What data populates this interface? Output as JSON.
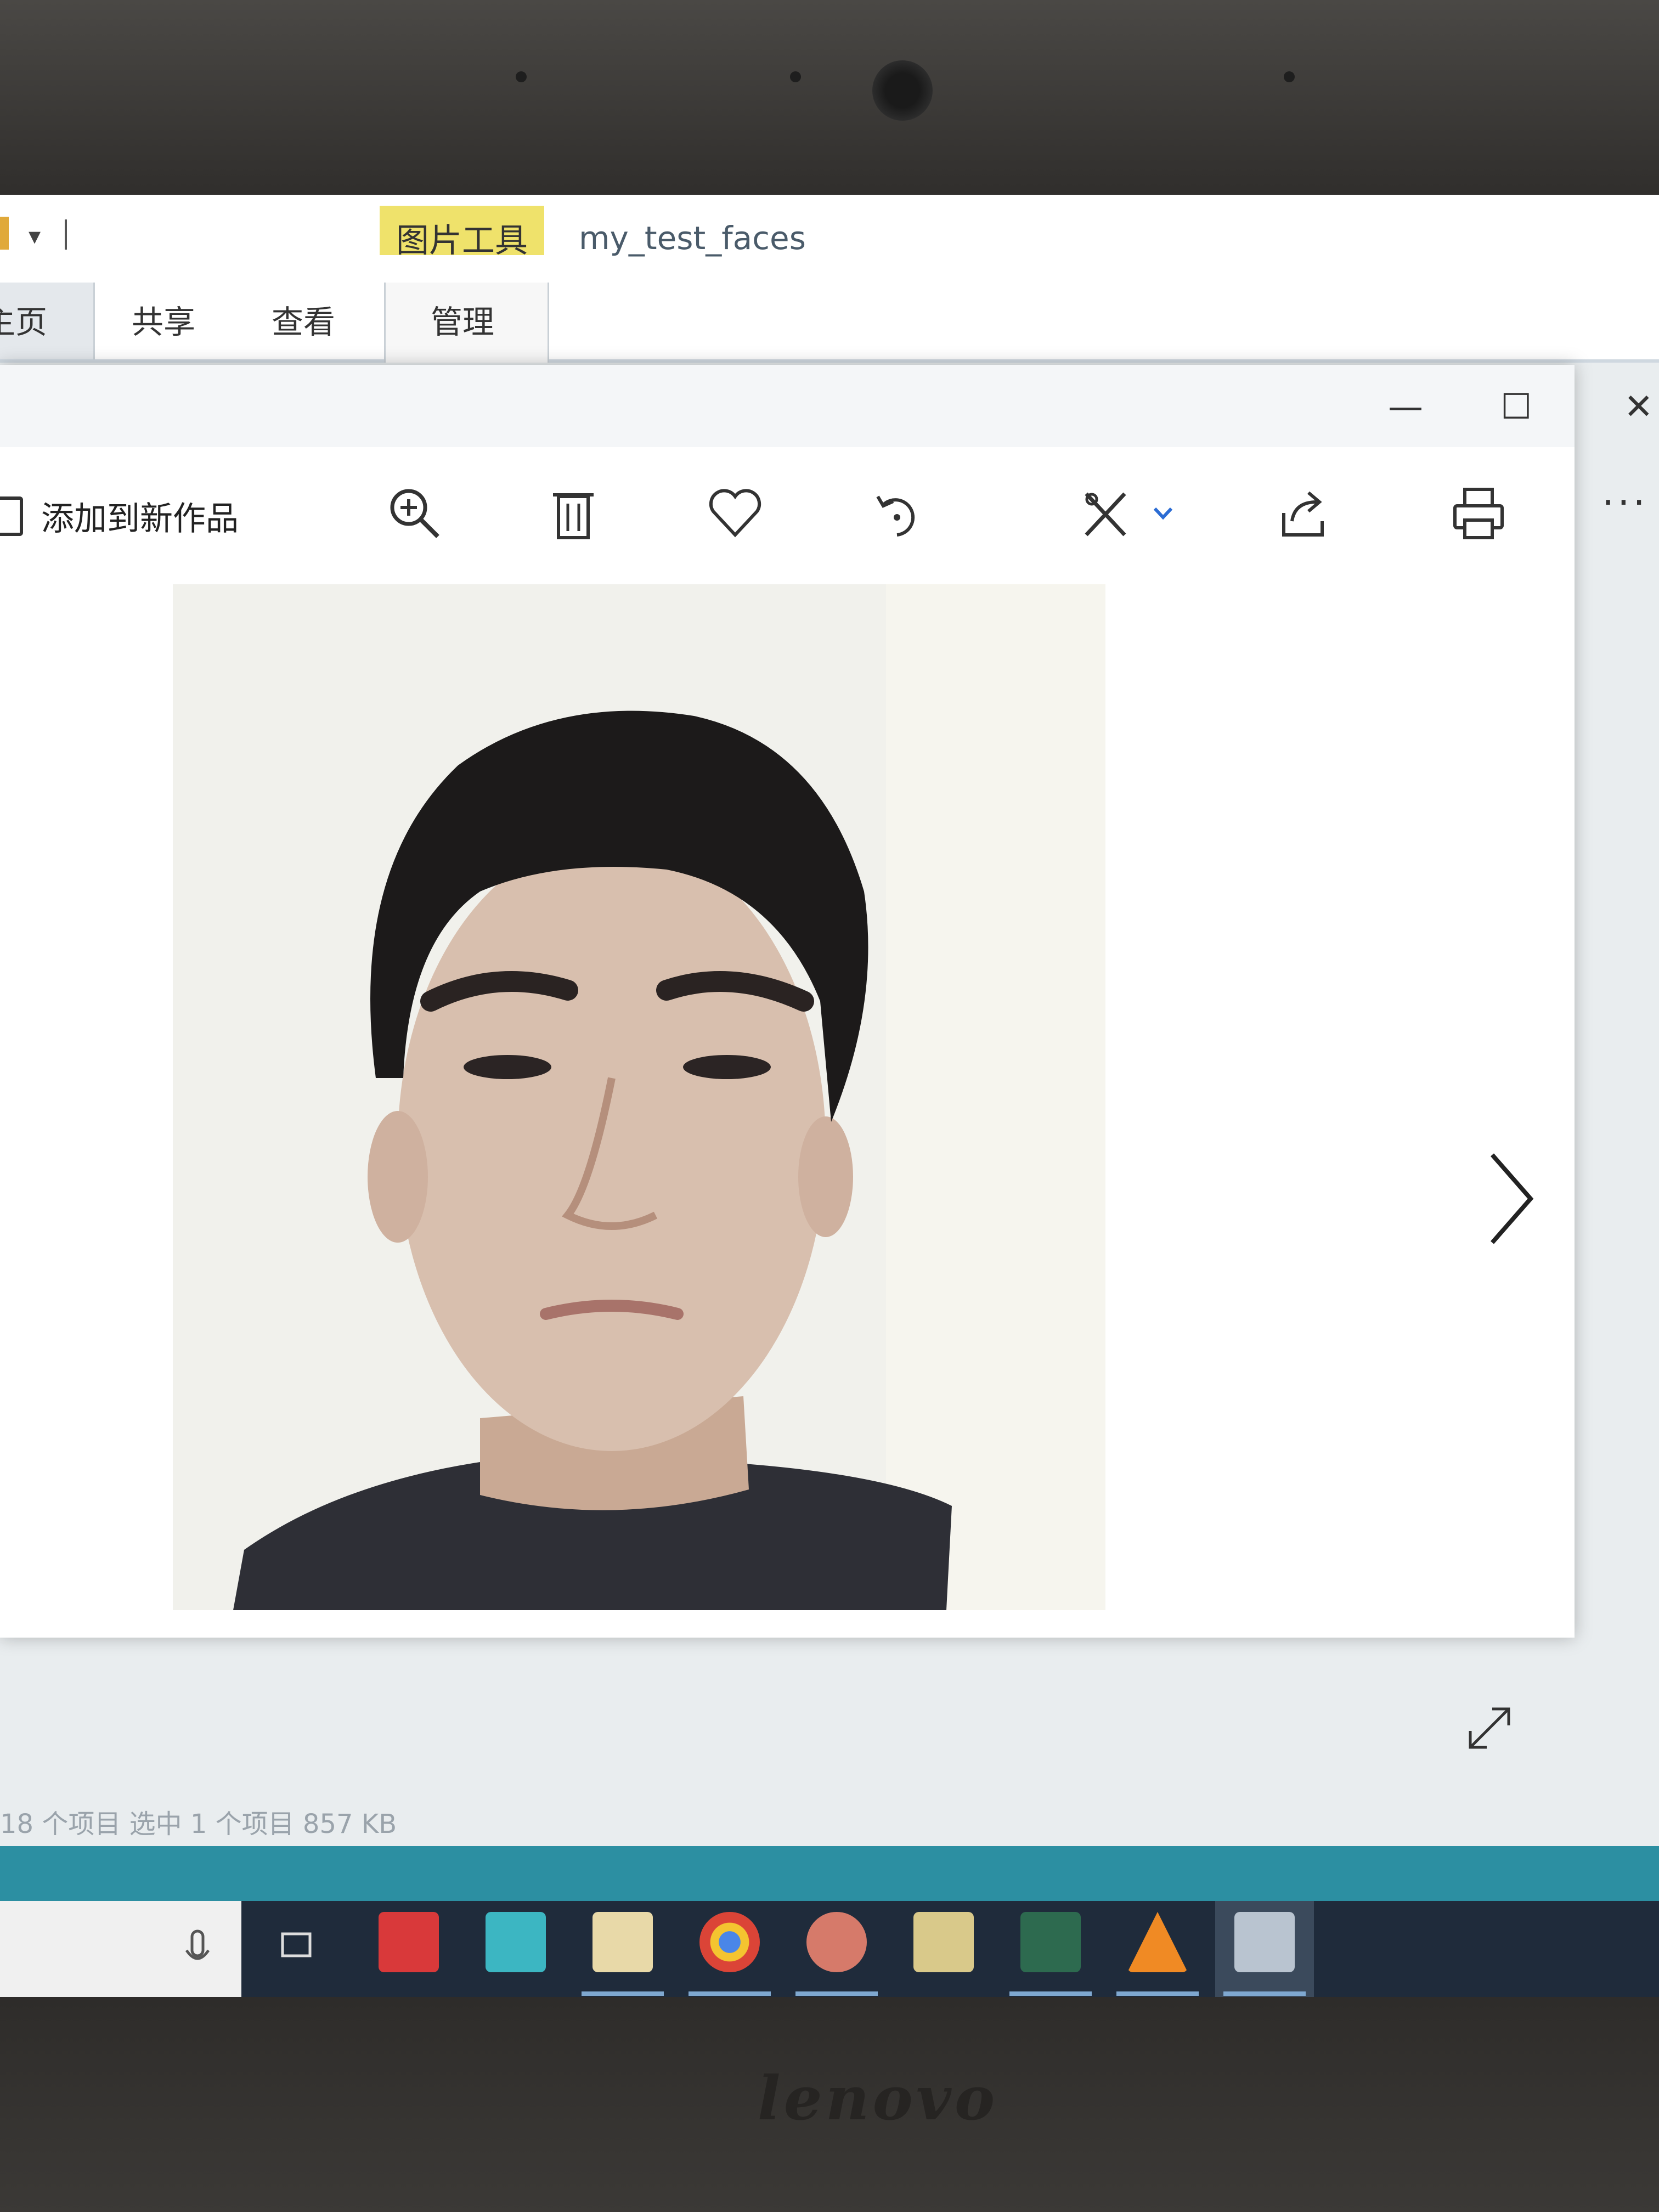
{
  "device": {
    "brand": "lenovo"
  },
  "explorer": {
    "quick_access_arrow": "▾",
    "context_tab": "图片工具",
    "window_title": "my_test_faces",
    "tabs": [
      "主页",
      "共享",
      "查看",
      "管理"
    ],
    "status_text": "18 个项目    选中 1 个项目  857 KB"
  },
  "photos_app": {
    "window_controls": {
      "minimize": "—",
      "maximize": "☐",
      "close": "✕"
    },
    "add_to_creation_label": "添加到新作品",
    "more_label": "···",
    "toolbar_icons": [
      "zoom-in-icon",
      "delete-icon",
      "favorite-icon",
      "rotate-icon",
      "edit-icon",
      "share-icon",
      "print-icon"
    ]
  },
  "taskbar": {
    "apps": [
      "task-view-icon",
      "netease-music-icon",
      "browser-icon",
      "file-explorer-icon",
      "chrome-icon",
      "snail-app-icon",
      "folder-icon",
      "pycharm-icon",
      "vlc-icon",
      "photos-icon"
    ]
  },
  "colors": {
    "context_tab": "#efe26b",
    "teal_band": "#2c8fa2",
    "taskbar": "#1f2b3b"
  }
}
